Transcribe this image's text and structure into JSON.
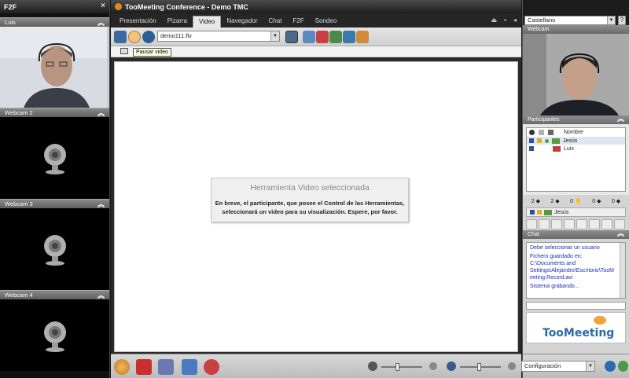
{
  "left_panel": {
    "title": "F2F",
    "close": "×",
    "cams": [
      {
        "label": "Luis"
      },
      {
        "label": "Webcam 2"
      },
      {
        "label": "Webcam 3"
      },
      {
        "label": "Webcam 4"
      }
    ]
  },
  "main": {
    "title": "TooMeeting Conference - Demo TMC",
    "tabs": [
      {
        "label": "Presentación"
      },
      {
        "label": "Pizarra"
      },
      {
        "label": "Video",
        "active": true
      },
      {
        "label": "Navegador"
      },
      {
        "label": "Chat"
      },
      {
        "label": "F2F"
      },
      {
        "label": "Sondeo"
      }
    ],
    "file_value": "demo111.flv",
    "tooltip": "Pausar video",
    "message_title": "Herramienta Video seleccionada",
    "message_body_line1": "En breve, el participante, que posee el Control de las Herramientas,",
    "message_body_line2": "seleccionará un video para su visualización. Espere, por favor."
  },
  "bottom": {
    "config_value": "Configuración"
  },
  "right_panel": {
    "language": "Castellano",
    "help": "?",
    "webcam_label": "Webcam",
    "participants_label": "Participantes",
    "col_name": "Nombre",
    "participants": [
      {
        "name": "Jesús"
      },
      {
        "name": "Luis"
      }
    ],
    "counts": [
      "2",
      "2",
      "0",
      "0",
      "0"
    ],
    "selected_user": "Jesús",
    "chat_label": "Chat",
    "chat_lines": [
      "Debe seleccionar un usuario",
      "Fichero guardado en:",
      "C:\\Documents and",
      "Settings\\Alejandro\\Escritorio\\TooM",
      "eeting.Record.avi",
      "Sistema grabando..."
    ],
    "logo": "TooMeeting"
  },
  "colors": {
    "accent_blue": "#2b6aa8",
    "chat_text": "#1a2fc0",
    "title_bar": "#1e1e1e"
  }
}
